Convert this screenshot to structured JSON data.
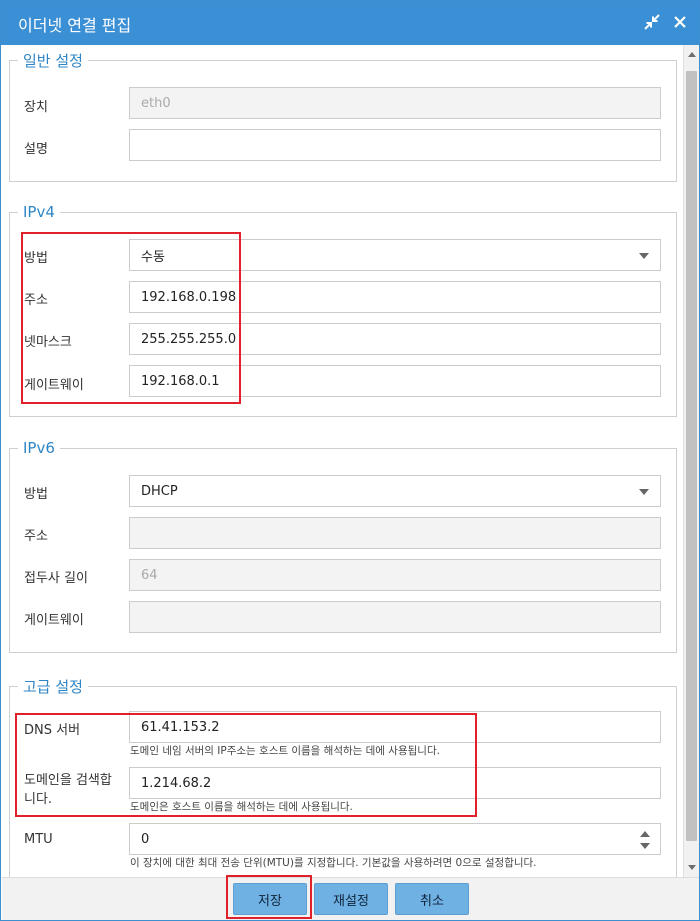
{
  "window": {
    "title": "이더넷 연결 편집"
  },
  "general": {
    "legend": "일반 설정",
    "device_label": "장치",
    "device_value": "eth0",
    "desc_label": "설명",
    "desc_value": ""
  },
  "ipv4": {
    "legend": "IPv4",
    "method_label": "방법",
    "method_value": "수동",
    "address_label": "주소",
    "address_value": "192.168.0.198",
    "netmask_label": "넷마스크",
    "netmask_value": "255.255.255.0",
    "gateway_label": "게이트웨이",
    "gateway_value": "192.168.0.1"
  },
  "ipv6": {
    "legend": "IPv6",
    "method_label": "방법",
    "method_value": "DHCP",
    "address_label": "주소",
    "address_value": "",
    "prefix_label": "접두사 길이",
    "prefix_value": "64",
    "gateway_label": "게이트웨이",
    "gateway_value": ""
  },
  "advanced": {
    "legend": "고급 설정",
    "dns_label": "DNS 서버",
    "dns_value": "61.41.153.2",
    "dns_hint": "도메인 네임 서버의 IP주소는 호스트 이름을 해석하는 데에 사용됩니다.",
    "search_label": "도메인을 검색합니다.",
    "search_value": "1.214.68.2",
    "search_hint": "도메인은 호스트 이름을 해석하는 데에 사용됩니다.",
    "mtu_label": "MTU",
    "mtu_value": "0",
    "mtu_hint": "이 장치에 대한 최대 전송 단위(MTU)를 지정합니다. 기본값을 사용하려면 0으로 설정합니다."
  },
  "footer": {
    "save_label": "저장",
    "reset_label": "재설정",
    "cancel_label": "취소"
  },
  "colors": {
    "titlebar": "#3b8fd4",
    "accent": "#2f86c6",
    "button": "#70b1e4",
    "highlight": "#e0202a"
  }
}
